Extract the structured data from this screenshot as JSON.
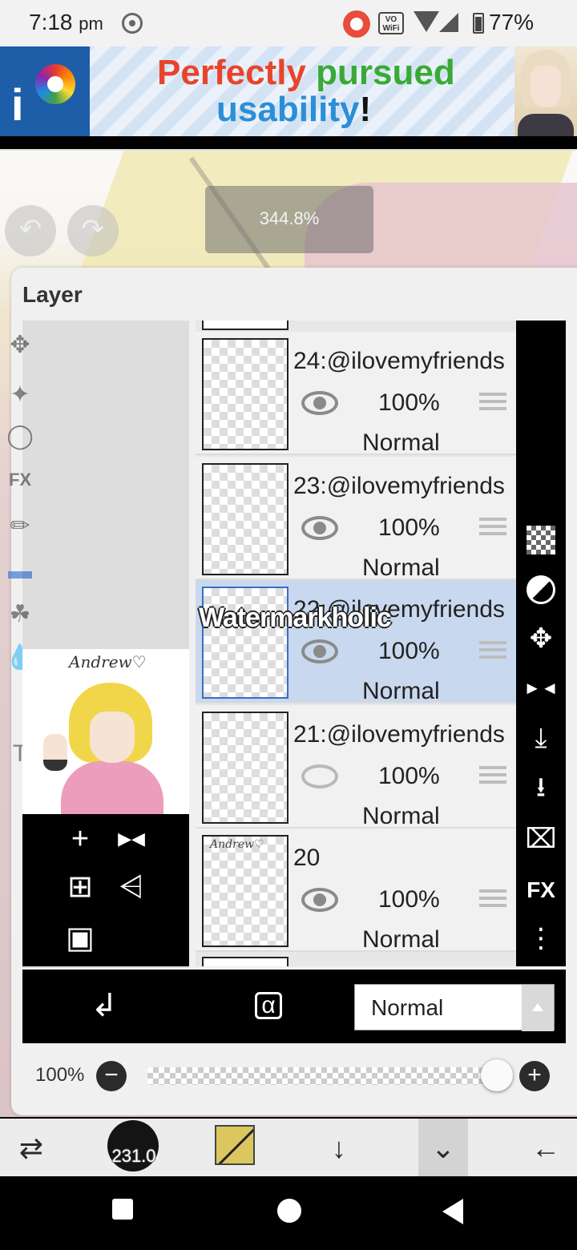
{
  "status_bar": {
    "time": "7:18",
    "ampm": "pm",
    "battery": "77%",
    "vo_wifi": "VO\nWiFi"
  },
  "ad": {
    "word1": "Perfectly",
    "word2": "pursued",
    "word3": "usability",
    "exclaim": "!",
    "logo_letter": "i"
  },
  "canvas": {
    "zoom": "344.8%"
  },
  "panel": {
    "title": "Layer",
    "preview_signature": "Andrew♡",
    "layers": [
      {
        "name": "24:@ilovemyfriends",
        "opacity": "100%",
        "blend": "Normal",
        "visible": true,
        "selected": false,
        "thumb_text": ""
      },
      {
        "name": "23:@ilovemyfriends",
        "opacity": "100%",
        "blend": "Normal",
        "visible": true,
        "selected": false,
        "thumb_text": ""
      },
      {
        "name": "22:@ilovemyfriends",
        "opacity": "100%",
        "blend": "Normal",
        "visible": true,
        "selected": true,
        "thumb_text": ""
      },
      {
        "name": "21:@ilovemyfriends",
        "opacity": "100%",
        "blend": "Normal",
        "visible": false,
        "selected": false,
        "thumb_text": ""
      },
      {
        "name": "20",
        "opacity": "100%",
        "blend": "Normal",
        "visible": true,
        "selected": false,
        "thumb_text": "Andrew♡"
      }
    ],
    "watermark": "Watermarkholic",
    "blend_mode": "Normal",
    "opacity_label": "100%",
    "opacity_value": 1.0,
    "right_fx": "FX"
  },
  "toolbar": {
    "brush_size": "231.0",
    "color": "#dcc75e"
  },
  "icons": {
    "undo": "↶",
    "redo": "↷",
    "add": "+",
    "flip": "▶◀",
    "add_copy": "⊞",
    "merge": "⩤",
    "camera": "▣",
    "clip": "↲",
    "lock": "α",
    "move": "✥",
    "flip_h": "►◄",
    "merge_down": "⤓",
    "save_down": "⭳",
    "trash": "⌧",
    "more": "⋮",
    "minus": "−",
    "plus": "+",
    "arrow_down": "↓",
    "collapse": "⌄",
    "back": "←",
    "tool_switch": "⇄"
  }
}
